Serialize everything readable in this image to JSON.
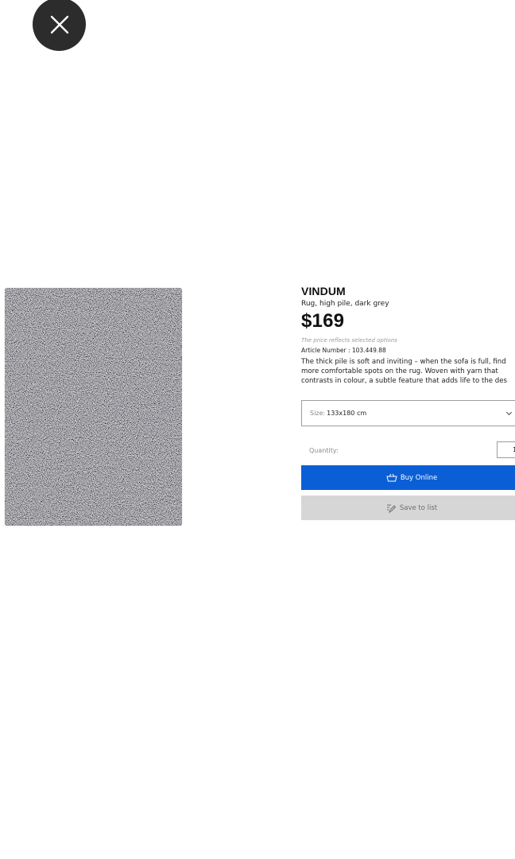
{
  "close": {
    "icon": "close-icon"
  },
  "product": {
    "name": "VINDUM",
    "short_description": "Rug, high pile, dark grey",
    "price": "$169",
    "price_note": "The price reflects selected options",
    "article_number": "Article Number : 103.449.88",
    "description_lines": [
      "The thick pile is soft and inviting – when the sofa is full, find",
      "more comfortable spots on the rug. Woven with yarn that",
      "contrasts in colour, a subtle feature that adds life to the des"
    ]
  },
  "size_select": {
    "label": "Size:",
    "value": "133x180 cm"
  },
  "quantity": {
    "label": "Quantity:",
    "value": "1"
  },
  "buttons": {
    "buy_label": "Buy Online",
    "buy_icon": "basket-icon",
    "save_label": "Save to list",
    "save_icon": "pencil-list-icon"
  },
  "colors": {
    "buy_button": "#0a5fd6",
    "save_button": "#d6d6d6",
    "close_button": "#2c2c2c"
  }
}
